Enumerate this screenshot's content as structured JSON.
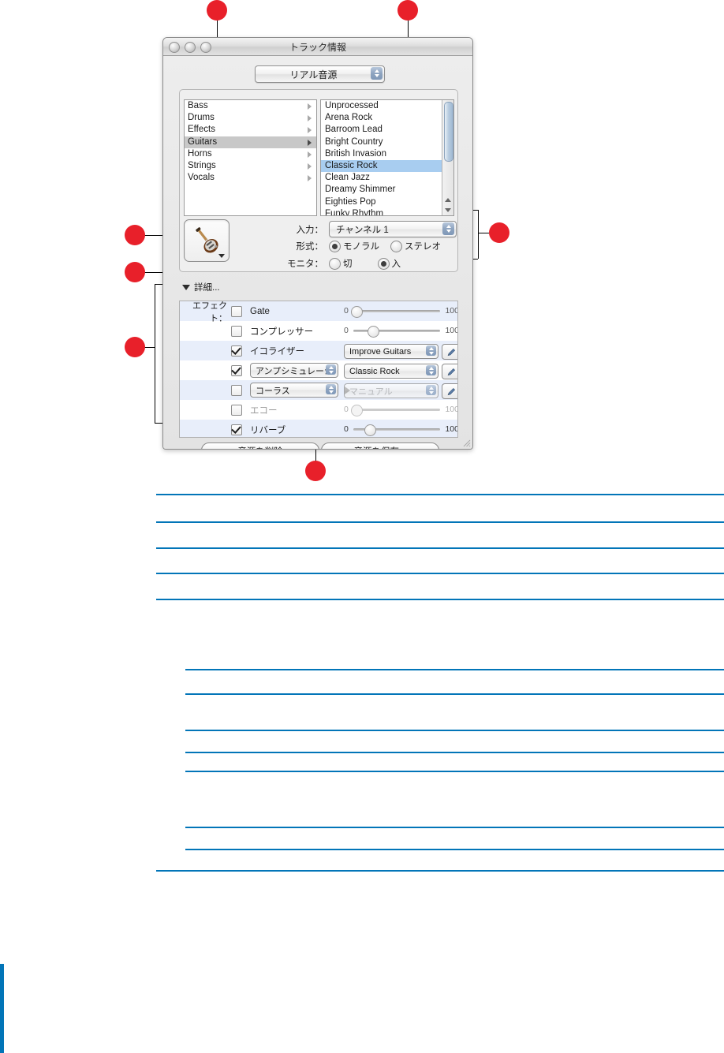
{
  "window": {
    "title": "トラック情報",
    "controls": [
      "close-button",
      "minimize-button",
      "zoom-button"
    ],
    "source_popup": {
      "value": "リアル音源"
    },
    "category_list": [
      {
        "label": "Bass",
        "selected": false
      },
      {
        "label": "Drums",
        "selected": false
      },
      {
        "label": "Effects",
        "selected": false
      },
      {
        "label": "Guitars",
        "selected": true
      },
      {
        "label": "Horns",
        "selected": false
      },
      {
        "label": "Strings",
        "selected": false
      },
      {
        "label": "Vocals",
        "selected": false
      }
    ],
    "preset_list": [
      {
        "label": "Unprocessed",
        "selected": false
      },
      {
        "label": "Arena Rock",
        "selected": false
      },
      {
        "label": "Barroom Lead",
        "selected": false
      },
      {
        "label": "Bright Country",
        "selected": false
      },
      {
        "label": "British Invasion",
        "selected": false
      },
      {
        "label": "Classic Rock",
        "selected": true
      },
      {
        "label": "Clean Jazz",
        "selected": false
      },
      {
        "label": "Dreamy Shimmer",
        "selected": false
      },
      {
        "label": "Eighties Pop",
        "selected": false
      },
      {
        "label": "Funky Rhythm",
        "selected": false
      }
    ],
    "instrument_icon": "electric-guitar-icon",
    "input": {
      "input_label": "入力：",
      "input_value": "チャンネル 1",
      "format_label": "形式：",
      "format_options": [
        {
          "label": "モノラル",
          "selected": true
        },
        {
          "label": "ステレオ",
          "selected": false
        }
      ],
      "monitor_label": "モニタ：",
      "monitor_options": [
        {
          "label": "切",
          "selected": false
        },
        {
          "label": "入",
          "selected": true
        }
      ]
    },
    "disclosure_label": "詳細...",
    "effects": {
      "header_label": "エフェクト：",
      "rows": [
        {
          "name": "Gate",
          "checked": false,
          "control": "slider",
          "min": "0",
          "max": "100",
          "value_pct": 3,
          "dim": false
        },
        {
          "name": "コンプレッサー",
          "checked": false,
          "control": "slider",
          "min": "0",
          "max": "100",
          "value_pct": 22,
          "dim": false
        },
        {
          "name": "イコライザー",
          "checked": true,
          "control": "preset",
          "preset": "Improve Guitars",
          "dim": false
        },
        {
          "name": "アンプシミュレーシ",
          "checked": true,
          "control": "select-preset",
          "preset": "Classic Rock",
          "dim": false
        },
        {
          "name": "コーラス",
          "checked": false,
          "control": "select-preset",
          "preset": "マニュアル",
          "dim": true
        },
        {
          "name": "エコー",
          "checked": false,
          "control": "slider",
          "min": "0",
          "max": "100",
          "value_pct": 3,
          "dim": true
        },
        {
          "name": "リバーブ",
          "checked": true,
          "control": "slider",
          "min": "0",
          "max": "100",
          "value_pct": 18,
          "dim": false
        }
      ]
    },
    "buttons": {
      "delete_label": "音源を削除",
      "save_label": "音源を保存..."
    }
  },
  "colors": {
    "rule_blue": "#0275b8",
    "callout_red": "#e8202a",
    "selection_blue": "#a8cdf0",
    "selection_gray": "#c8c8c8"
  }
}
